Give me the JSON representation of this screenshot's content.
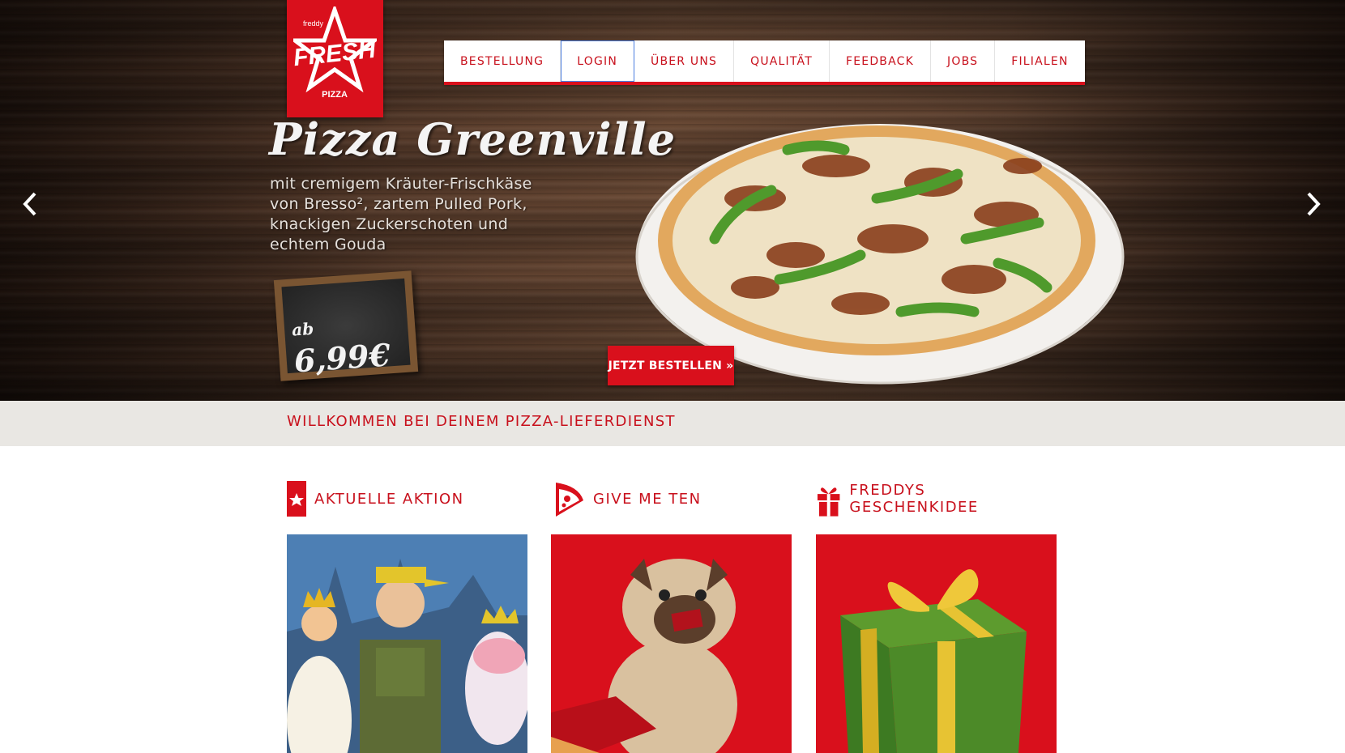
{
  "brand": {
    "logo_top": "freddy",
    "logo_main": "FRESH",
    "logo_sub": "PIZZA"
  },
  "nav": {
    "items": [
      {
        "label": "BESTELLUNG"
      },
      {
        "label": "LOGIN"
      },
      {
        "label": "ÜBER UNS"
      },
      {
        "label": "QUALITÄT"
      },
      {
        "label": "FEEDBACK"
      },
      {
        "label": "JOBS"
      },
      {
        "label": "FILIALEN"
      }
    ]
  },
  "hero": {
    "title": "Pizza Greenville",
    "description": "mit cremigem Kräuter-Frischkäse von Bresso², zartem Pulled Pork, knackigen Zuckerschoten und echtem Gouda",
    "price_prefix": "ab",
    "price": "6,99€",
    "cta_label": "JETZT BESTELLEN »",
    "prev_icon": "chevron-left-icon",
    "next_icon": "chevron-right-icon"
  },
  "welcome": {
    "text": "WILLKOMMEN BEI DEINEM PIZZA-LIEFERDIENST"
  },
  "sections": [
    {
      "title": "AKTUELLE AKTION",
      "icon": "star-bookmark-icon"
    },
    {
      "title": "GIVE ME TEN",
      "icon": "pizza-slice-icon"
    },
    {
      "title": "FREDDYS GESCHENKIDEE",
      "icon": "gift-icon"
    }
  ],
  "colors": {
    "brand_red": "#d9101c",
    "text_red": "#c8101c",
    "welcome_bg": "#e9e7e3"
  }
}
